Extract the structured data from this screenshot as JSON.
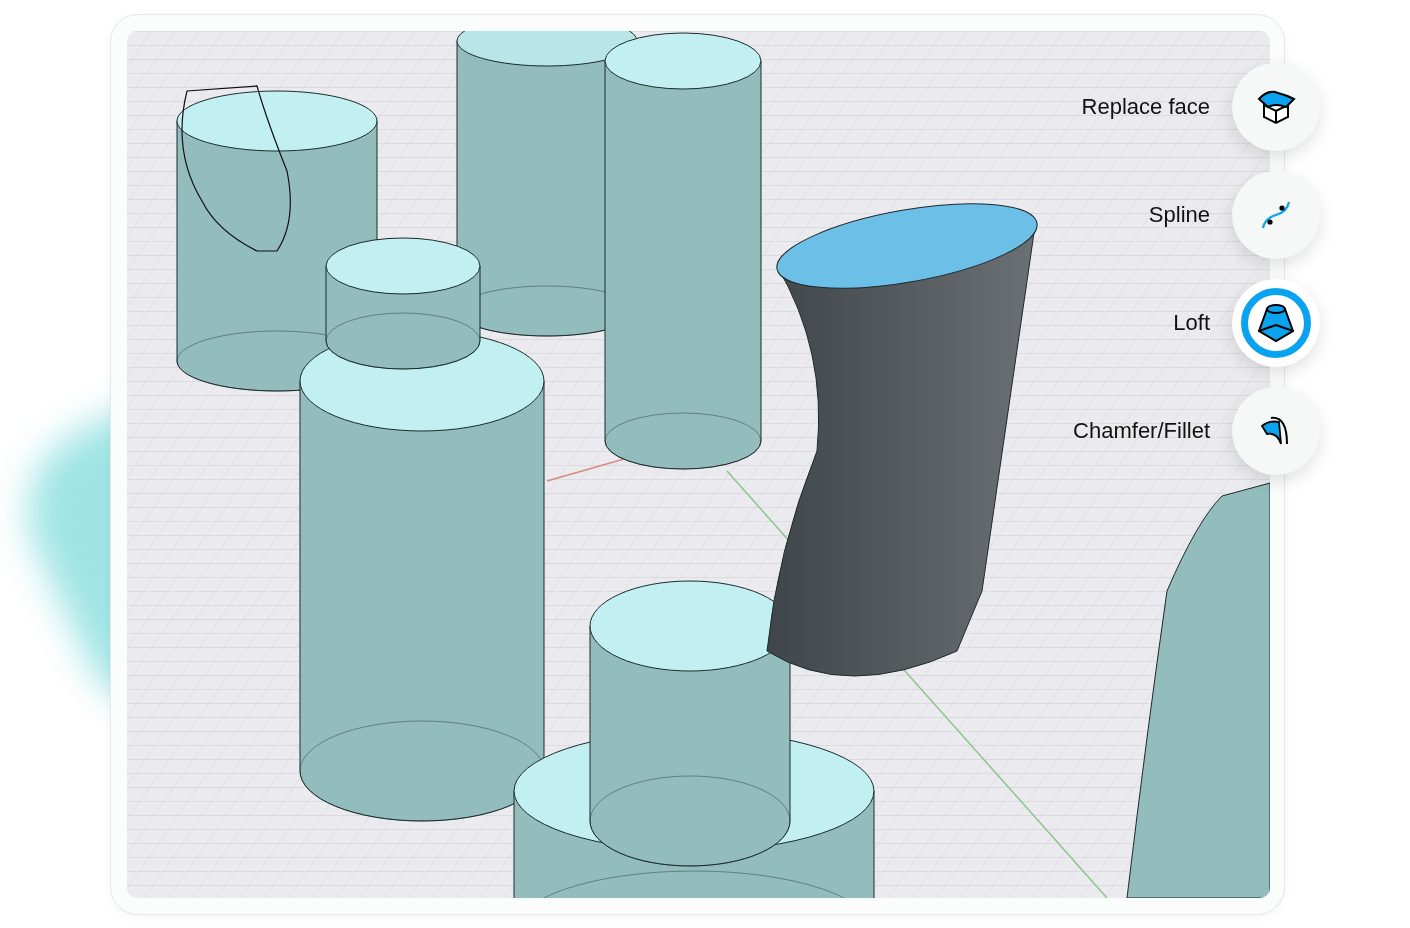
{
  "tools": [
    {
      "label": "Replace face",
      "kind": "replace-face",
      "selected": false
    },
    {
      "label": "Spline",
      "kind": "spline",
      "selected": false
    },
    {
      "label": "Loft",
      "kind": "loft",
      "selected": true
    },
    {
      "label": "Chamfer/Fillet",
      "kind": "chamfer",
      "selected": false
    }
  ]
}
